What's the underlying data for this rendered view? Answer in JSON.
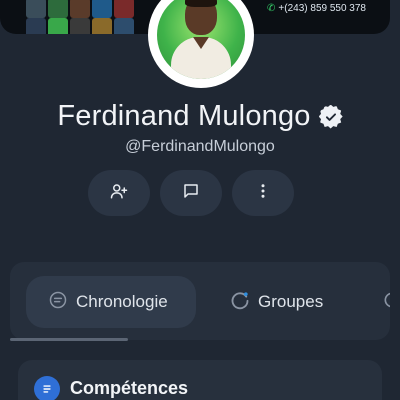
{
  "cover": {
    "phone": "+(243) 859 550 378",
    "phone_icon": "phone-icon"
  },
  "profile": {
    "name": "Ferdinand Mulongo",
    "handle": "@FerdinandMulongo",
    "verified_icon": "verified-badge-icon"
  },
  "actions": [
    {
      "icon": "add-friend-icon"
    },
    {
      "icon": "message-icon"
    },
    {
      "icon": "more-vertical-icon"
    }
  ],
  "tabs": [
    {
      "label": "Chronologie",
      "icon": "timeline-icon",
      "active": true
    },
    {
      "label": "Groupes",
      "icon": "groups-icon",
      "active": false
    }
  ],
  "sections": {
    "competences": {
      "title": "Compétences",
      "icon": "document-icon"
    }
  },
  "colors": {
    "background": "#1f2733",
    "card": "#262f3c",
    "accent": "#2f6fd6",
    "phone_green": "#35d06a"
  }
}
